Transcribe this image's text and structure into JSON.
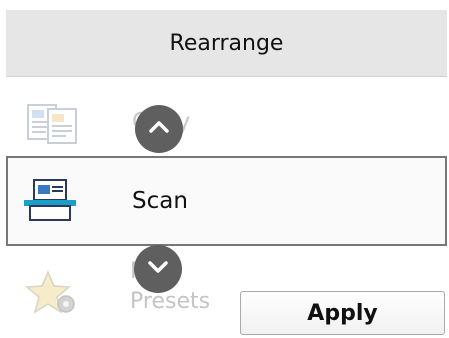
{
  "header": {
    "title": "Rearrange"
  },
  "items": [
    {
      "label": "Copy",
      "icon": "copy-icon",
      "state": "faded"
    },
    {
      "label": "Scan",
      "icon": "scan-icon",
      "state": "selected"
    },
    {
      "label_line1": "My",
      "label_line2": "Presets",
      "icon": "star-gear-icon",
      "state": "faded"
    }
  ],
  "controls": {
    "up_icon": "chevron-up-icon",
    "down_icon": "chevron-down-icon",
    "apply_label": "Apply"
  },
  "colors": {
    "header_bg": "#e6e6e6",
    "arrow_bg": "#5f5f5f",
    "scan_accent": "#1aa0c8"
  }
}
